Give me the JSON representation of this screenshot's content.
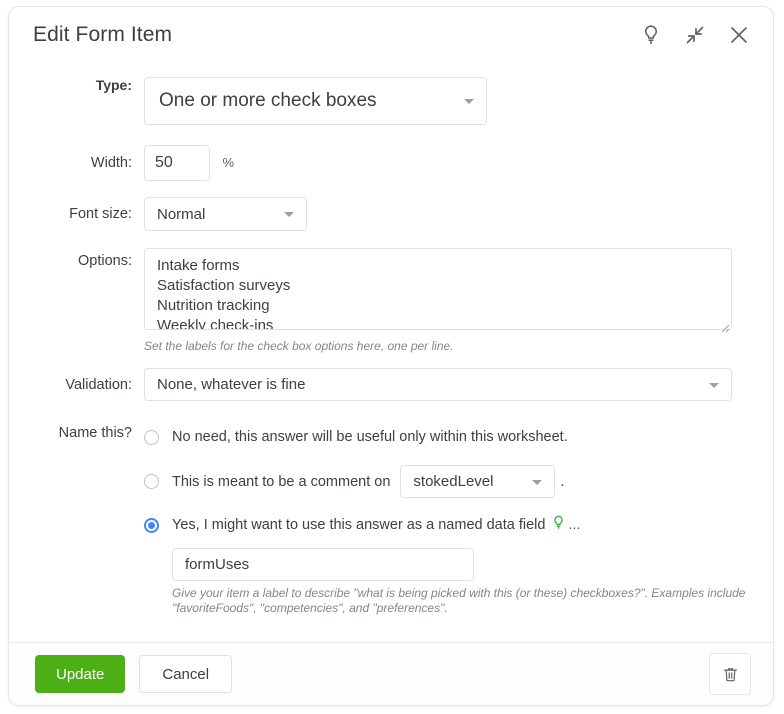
{
  "dialog": {
    "title": "Edit Form Item",
    "header_icons": [
      {
        "name": "lightbulb-icon",
        "label": "Help"
      },
      {
        "name": "collapse-icon",
        "label": "Collapse"
      },
      {
        "name": "close-icon",
        "label": "Close"
      }
    ]
  },
  "fields": {
    "type": {
      "label": "Type:",
      "value": "One or more check boxes"
    },
    "width": {
      "label": "Width:",
      "value": "50",
      "suffix": "%"
    },
    "font_size": {
      "label": "Font size:",
      "value": "Normal"
    },
    "options": {
      "label": "Options:",
      "value": "Intake forms\nSatisfaction surveys\nNutrition tracking\nWeekly check-ins",
      "hint": "Set the labels for the check box options here, one per line."
    },
    "validation": {
      "label": "Validation:",
      "value": "None, whatever is fine"
    },
    "name_this": {
      "label": "Name this?",
      "options": [
        {
          "text": "No need, this answer will be useful only within this worksheet.",
          "selected": false
        },
        {
          "text": "This is meant to be a comment on",
          "selected": false,
          "dropdown_value": "stokedLevel",
          "trailing": "."
        },
        {
          "text": "Yes, I might want to use this answer as a named data field",
          "selected": true,
          "trailing_dots": "..."
        }
      ],
      "name_input": {
        "value": "formUses",
        "hint": "Give your item a label to describe \"what is being picked with this (or these) checkboxes?\". Examples include \"favoriteFoods\", \"competencies\", and \"preferences\"."
      }
    }
  },
  "footer": {
    "update_label": "Update",
    "cancel_label": "Cancel",
    "delete_icon": "trash-icon"
  },
  "colors": {
    "primary_green": "#4caf16",
    "radio_blue": "#4285f4",
    "bulb_green": "#39b54a"
  }
}
